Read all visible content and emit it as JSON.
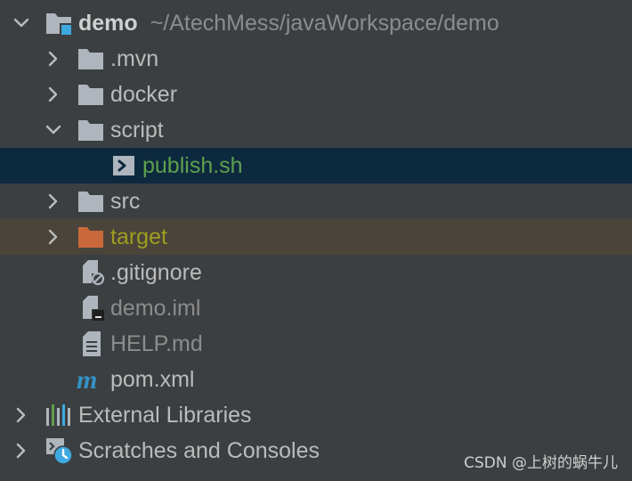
{
  "colors": {
    "background": "#3c3f41",
    "selected_row": "#0d293e",
    "highlight_row": "#4b443a",
    "default_text": "#bbbbbb",
    "dim_text": "#8c8c8c",
    "green_text": "#5fa04e",
    "olive_text": "#9e9e1f",
    "folder_gray": "#aeb5bd",
    "folder_orange": "#c9693b",
    "module_blue": "#3ea8e1",
    "maven_blue": "#3592c4"
  },
  "project": {
    "name": "demo",
    "path": "~/AtechMess/javaWorkspace/demo",
    "icon": "module-folder-icon"
  },
  "items": [
    {
      "label": ".mvn",
      "icon": "folder-icon",
      "expanded": false
    },
    {
      "label": "docker",
      "icon": "folder-icon",
      "expanded": false
    },
    {
      "label": "script",
      "icon": "folder-icon",
      "expanded": true
    },
    {
      "label": "publish.sh",
      "icon": "shell-script-icon",
      "selected": true
    },
    {
      "label": "src",
      "icon": "folder-icon",
      "expanded": false
    },
    {
      "label": "target",
      "icon": "excluded-folder-icon",
      "expanded": false
    },
    {
      "label": ".gitignore",
      "icon": "ignored-file-icon"
    },
    {
      "label": "demo.iml",
      "icon": "module-file-icon"
    },
    {
      "label": "HELP.md",
      "icon": "markdown-file-icon"
    },
    {
      "label": "pom.xml",
      "icon": "maven-icon"
    }
  ],
  "external_libraries": {
    "label": "External Libraries",
    "icon": "libraries-icon"
  },
  "scratches": {
    "label": "Scratches and Consoles",
    "icon": "scratches-icon"
  },
  "watermark": "CSDN @上树的蜗牛儿"
}
